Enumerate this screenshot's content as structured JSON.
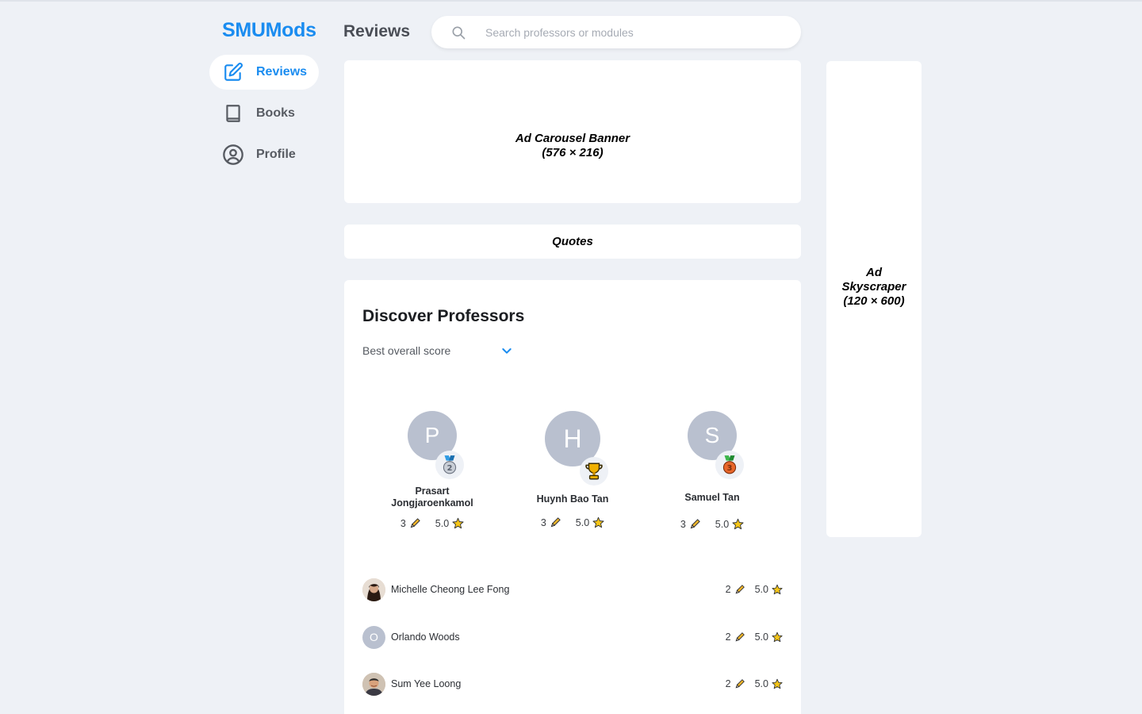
{
  "app": {
    "brand": "SMUMods",
    "page_title": "Reviews"
  },
  "search": {
    "placeholder": "Search professors or modules",
    "value": ""
  },
  "nav": {
    "items": [
      {
        "label": "Reviews",
        "icon": "edit-icon",
        "active": true
      },
      {
        "label": "Books",
        "icon": "book-icon",
        "active": false
      },
      {
        "label": "Profile",
        "icon": "user-circle-icon",
        "active": false
      }
    ]
  },
  "ads": {
    "banner_line1": "Ad Carousel Banner",
    "banner_line2": "(576 × 216)",
    "skyscraper_line1": "Ad",
    "skyscraper_line2": "Skyscraper",
    "skyscraper_line3": "(120 × 600)"
  },
  "quotes": {
    "label": "Quotes"
  },
  "discover": {
    "title": "Discover Professors",
    "sort_selected": "Best overall score",
    "top3": [
      {
        "initial": "P",
        "name": "Prasart Jongjaroenkamol",
        "reviews": "3",
        "score": "5.0",
        "medal": "silver-medal-icon"
      },
      {
        "initial": "H",
        "name": "Huynh Bao Tan",
        "reviews": "3",
        "score": "5.0",
        "medal": "trophy-icon"
      },
      {
        "initial": "S",
        "name": "Samuel Tan",
        "reviews": "3",
        "score": "5.0",
        "medal": "bronze-medal-icon"
      }
    ],
    "list": [
      {
        "initial": "",
        "name": "Michelle Cheong Lee Fong",
        "reviews": "2",
        "score": "5.0",
        "avatar": "photo"
      },
      {
        "initial": "O",
        "name": "Orlando Woods",
        "reviews": "2",
        "score": "5.0",
        "avatar": "initial"
      },
      {
        "initial": "",
        "name": "Sum Yee Loong",
        "reviews": "2",
        "score": "5.0",
        "avatar": "photo"
      }
    ]
  },
  "colors": {
    "accent": "#1a8cf0",
    "background": "#eef1f6",
    "avatar_grey": "#b9c0cf",
    "star": "#f5c518",
    "pencil": "#e6a817"
  }
}
